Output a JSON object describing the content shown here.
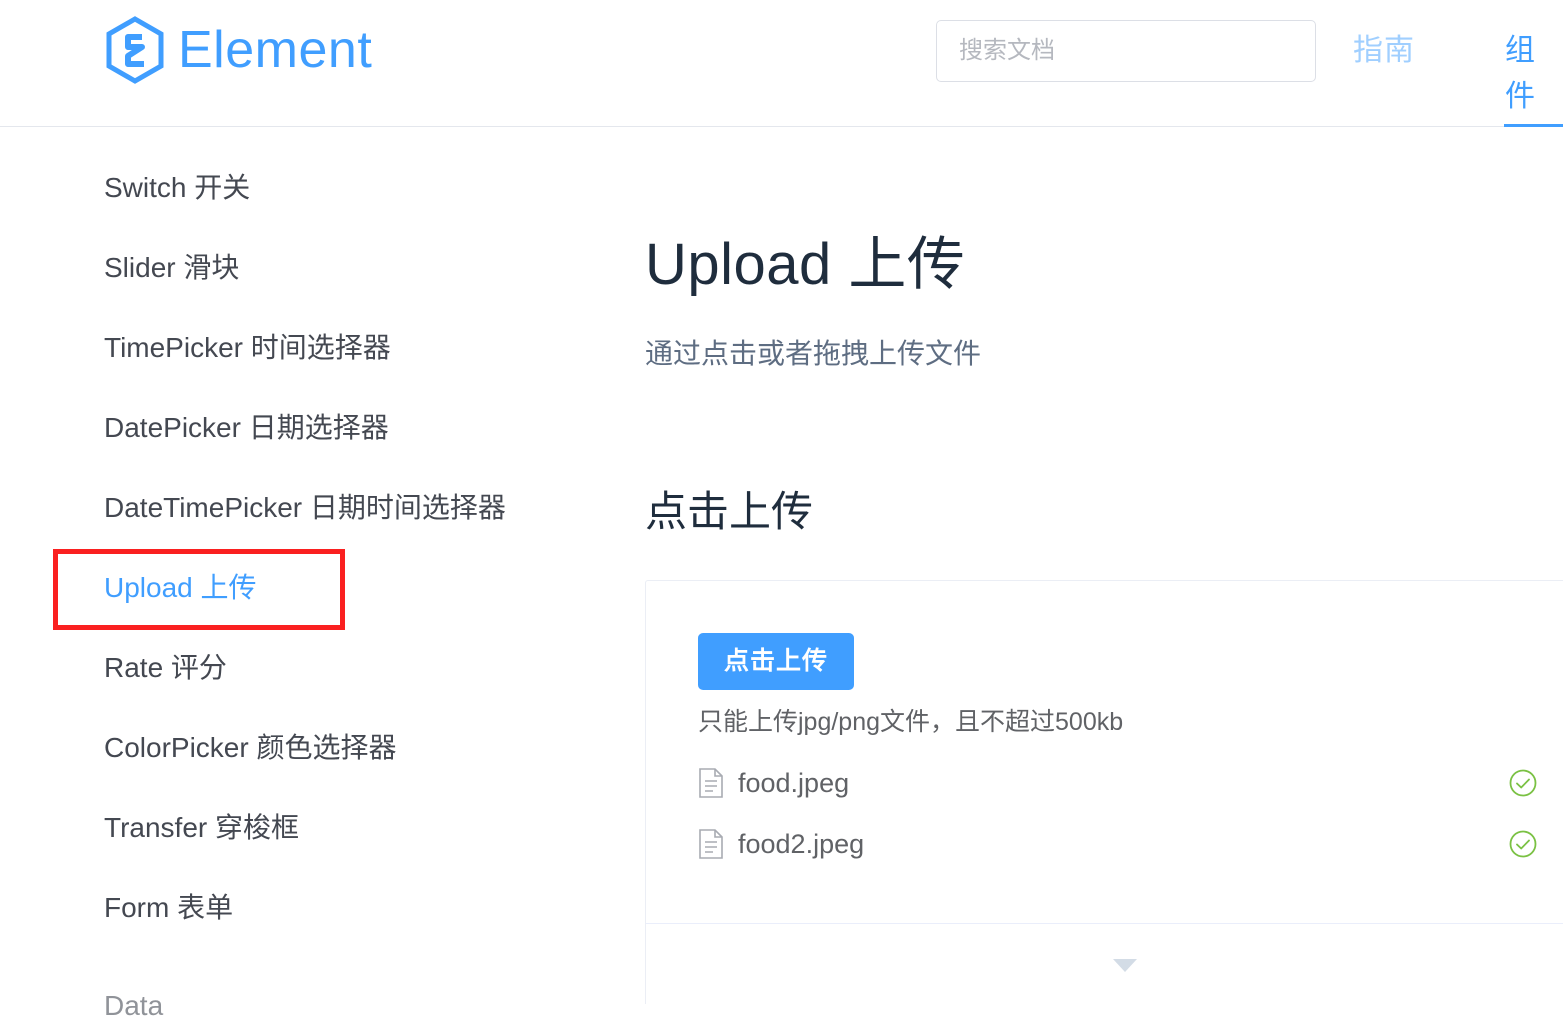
{
  "header": {
    "logo_text": "Element",
    "logo_icon": "element-hexagon-logo",
    "search": {
      "placeholder": "搜索文档",
      "value": ""
    },
    "nav": [
      {
        "label": "指南",
        "active": false
      },
      {
        "label": "组件",
        "active": true
      }
    ],
    "accent_color": "#409eff",
    "inactive_nav_color": "#a0cfff"
  },
  "sidebar": {
    "items": [
      {
        "label": "Switch 开关",
        "active": false
      },
      {
        "label": "Slider 滑块",
        "active": false
      },
      {
        "label": "TimePicker 时间选择器",
        "active": false
      },
      {
        "label": "DatePicker 日期选择器",
        "active": false
      },
      {
        "label": "DateTimePicker 日期时间选择器",
        "active": false
      },
      {
        "label": "Upload 上传",
        "active": true
      },
      {
        "label": "Rate 评分",
        "active": false
      },
      {
        "label": "ColorPicker 颜色选择器",
        "active": false
      },
      {
        "label": "Transfer 穿梭框",
        "active": false
      },
      {
        "label": "Form 表单",
        "active": false
      },
      {
        "label": "Data",
        "active": false
      }
    ],
    "highlight": {
      "target_label": "Upload 上传",
      "color": "#fa2020"
    }
  },
  "main": {
    "title": "Upload 上传",
    "subtitle": "通过点击或者拖拽上传文件",
    "section_title": "点击上传",
    "demo": {
      "upload_button_label": "点击上传",
      "upload_button_color": "#409eff",
      "tip": "只能上传jpg/png文件，且不超过500kb",
      "files": [
        {
          "name": "food.jpeg",
          "icon": "document-icon",
          "status": "success",
          "status_icon": "circle-check-icon"
        },
        {
          "name": "food2.jpeg",
          "icon": "document-icon",
          "status": "success",
          "status_icon": "circle-check-icon"
        }
      ],
      "success_color": "#67c23a",
      "expand_icon": "caret-down-icon"
    }
  }
}
